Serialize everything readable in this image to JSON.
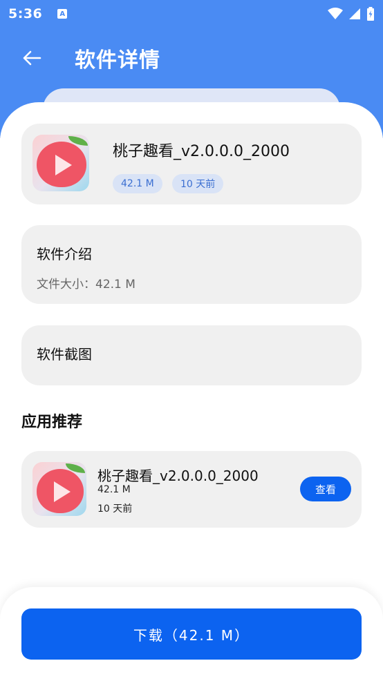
{
  "status_bar": {
    "time": "5:36",
    "notification_letter": "A"
  },
  "app_bar": {
    "title": "软件详情"
  },
  "app": {
    "name": "桃子趣看_v2.0.0.0_2000",
    "size_tag": "42.1 M",
    "time_tag": "10 天前"
  },
  "intro": {
    "title": "软件介绍",
    "size_text": "文件大小：42.1 M"
  },
  "screenshots": {
    "title": "软件截图"
  },
  "recommend": {
    "section_title": "应用推荐",
    "items": [
      {
        "name": "桃子趣看_v2.0.0.0_2000",
        "size": "42.1 M",
        "time": "10 天前",
        "button_label": "查看"
      }
    ]
  },
  "download": {
    "label": "下载（42.1 M）"
  },
  "colors": {
    "header": "#4a8bf3",
    "primary": "#0c63f0",
    "card": "#f0f0f0",
    "tag_bg": "#d9e3f6"
  }
}
